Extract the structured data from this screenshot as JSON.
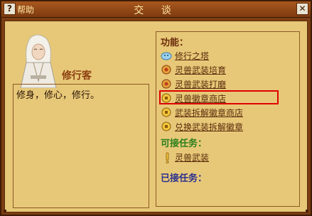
{
  "titlebar": {
    "help_label": "帮助",
    "title": "交 谈",
    "help_icon": "question-icon",
    "close_icon": "close-icon"
  },
  "npc": {
    "name": "修行客",
    "dialog": "修身，修心，修行。"
  },
  "functions": {
    "title": "功能：",
    "items": [
      {
        "label": "修行之塔",
        "icon": "cloud-icon"
      },
      {
        "label": "灵兽武装培育",
        "icon": "gear-icon"
      },
      {
        "label": "灵兽武装打磨",
        "icon": "gear-icon"
      },
      {
        "label": "灵兽徽章商店",
        "icon": "badge-coin-icon",
        "highlighted": true
      },
      {
        "label": "武装拆解徽章商店",
        "icon": "badge-coin-icon"
      },
      {
        "label": "兑换武装拆解徽章",
        "icon": "badge-coin-icon"
      }
    ]
  },
  "available_tasks": {
    "title": "可接任务：",
    "items": [
      {
        "label": "灵兽武装",
        "icon": "exclamation-icon"
      }
    ]
  },
  "accepted_tasks": {
    "title": "已接任务："
  },
  "colors": {
    "frame": "#7a3d12",
    "panel": "#e7c878",
    "highlight": "#e00000"
  }
}
